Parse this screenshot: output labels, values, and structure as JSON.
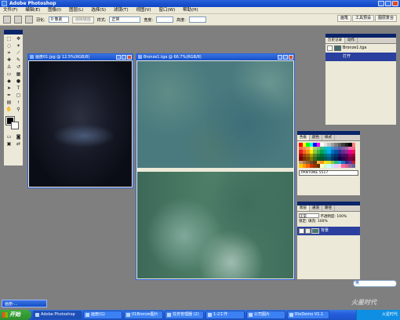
{
  "app": {
    "title": "Adobe Photoshop"
  },
  "menu": [
    "文件(F)",
    "编辑(E)",
    "图像(I)",
    "图层(L)",
    "选择(S)",
    "滤镜(T)",
    "视图(V)",
    "窗口(W)",
    "帮助(H)"
  ],
  "options": {
    "feather_label": "羽化:",
    "feather_value": "0 像素",
    "antialias_label": "消除锯齿",
    "style_label": "样式:",
    "style_value": "正常",
    "width_label": "宽度:",
    "height_label": "高度:"
  },
  "palette_well": {
    "tab1": "画笔",
    "tab2": "工具预设",
    "tab3": "图层复合"
  },
  "documents": [
    {
      "title": "画册01.jpg @ 12.5%(RGB/8)"
    },
    {
      "title": "Bronze1.tga @ 66.7%(RGB/8)"
    }
  ],
  "history_panel": {
    "tabs": [
      "历史记录",
      "动作"
    ],
    "snapshot": "Bronze1.tga",
    "states": [
      "打开"
    ]
  },
  "swatches_panel": {
    "tabs": [
      "色板",
      "颜色",
      "样式"
    ],
    "pantone_label": "PANTONE 5517",
    "colors": [
      "#ff0000",
      "#ffff00",
      "#00ff00",
      "#00ffff",
      "#0000ff",
      "#ff00ff",
      "#ffffff",
      "#e0e0e0",
      "#c0c0c0",
      "#a0a0a0",
      "#808080",
      "#606060",
      "#404040",
      "#202020",
      "#000000",
      "#ff8080",
      "#f26c4f",
      "#f68e55",
      "#fbaf5c",
      "#fff467",
      "#acd372",
      "#7cc576",
      "#3bb878",
      "#1abbb4",
      "#00bff3",
      "#438ccb",
      "#5574b9",
      "#605ca8",
      "#855fa8",
      "#a763a8",
      "#f06ea9",
      "#f26d7d",
      "#ed1c24",
      "#f26522",
      "#f7941d",
      "#fff200",
      "#8dc73f",
      "#39b54a",
      "#00a651",
      "#00a99d",
      "#00aeef",
      "#0072bc",
      "#0054a6",
      "#2e3192",
      "#662d91",
      "#92278f",
      "#ec008c",
      "#ed145b",
      "#9e0b0f",
      "#a0410d",
      "#a3620a",
      "#aba000",
      "#598527",
      "#197b30",
      "#007236",
      "#00746b",
      "#0076a3",
      "#004a80",
      "#003471",
      "#1b1464",
      "#440e62",
      "#630460",
      "#9e005d",
      "#9e0039",
      "#790000",
      "#7b2e00",
      "#7d4900",
      "#827b00",
      "#406618",
      "#005e20",
      "#005826",
      "#005952",
      "#005b7f",
      "#003663",
      "#002157",
      "#0d004c",
      "#32004b",
      "#4b0049",
      "#7b0046",
      "#7a0026",
      "#c69c6d",
      "#a67c52",
      "#8c6239",
      "#754c24",
      "#603913",
      "#fbb040",
      "#f7941d",
      "#ffde17",
      "#d7df23",
      "#8dc63f",
      "#2bb673",
      "#27aae1",
      "#1c75bc",
      "#2e3192",
      "#662d91",
      "#be1e2d",
      "#ffcc00",
      "#ff9900",
      "#ff6600",
      "#cc3300",
      "#993300",
      "#663300",
      "#ffffcc",
      "#ccffcc",
      "#ccffff",
      "#cce5ff",
      "#e5ccff",
      "#ffcce5",
      "#ff6699",
      "#cc6699",
      "#996699",
      "#666699"
    ]
  },
  "layers_panel": {
    "tabs": [
      "图层",
      "通道",
      "路径"
    ],
    "blend_mode": "正常",
    "opacity_label": "不透明度:",
    "opacity_value": "100%",
    "lock_label": "锁定:",
    "fill_label": "填充:",
    "fill_value": "100%",
    "layer_name": "背景"
  },
  "minimized_doc": {
    "title": "画册-..."
  },
  "im_bar": {
    "label": "英"
  },
  "taskbar": {
    "start_label": "开始",
    "items": [
      {
        "label": "Adobe Photoshop",
        "active": true
      },
      {
        "label": "画册(G)"
      },
      {
        "label": "01Bronze图片"
      },
      {
        "label": "任务管理器 (2)"
      },
      {
        "label": "1-2工作"
      },
      {
        "label": "公司图片"
      },
      {
        "label": "RtxDemo V1.1"
      }
    ],
    "tray_text": "火星时代"
  },
  "watermark": "火星时代"
}
